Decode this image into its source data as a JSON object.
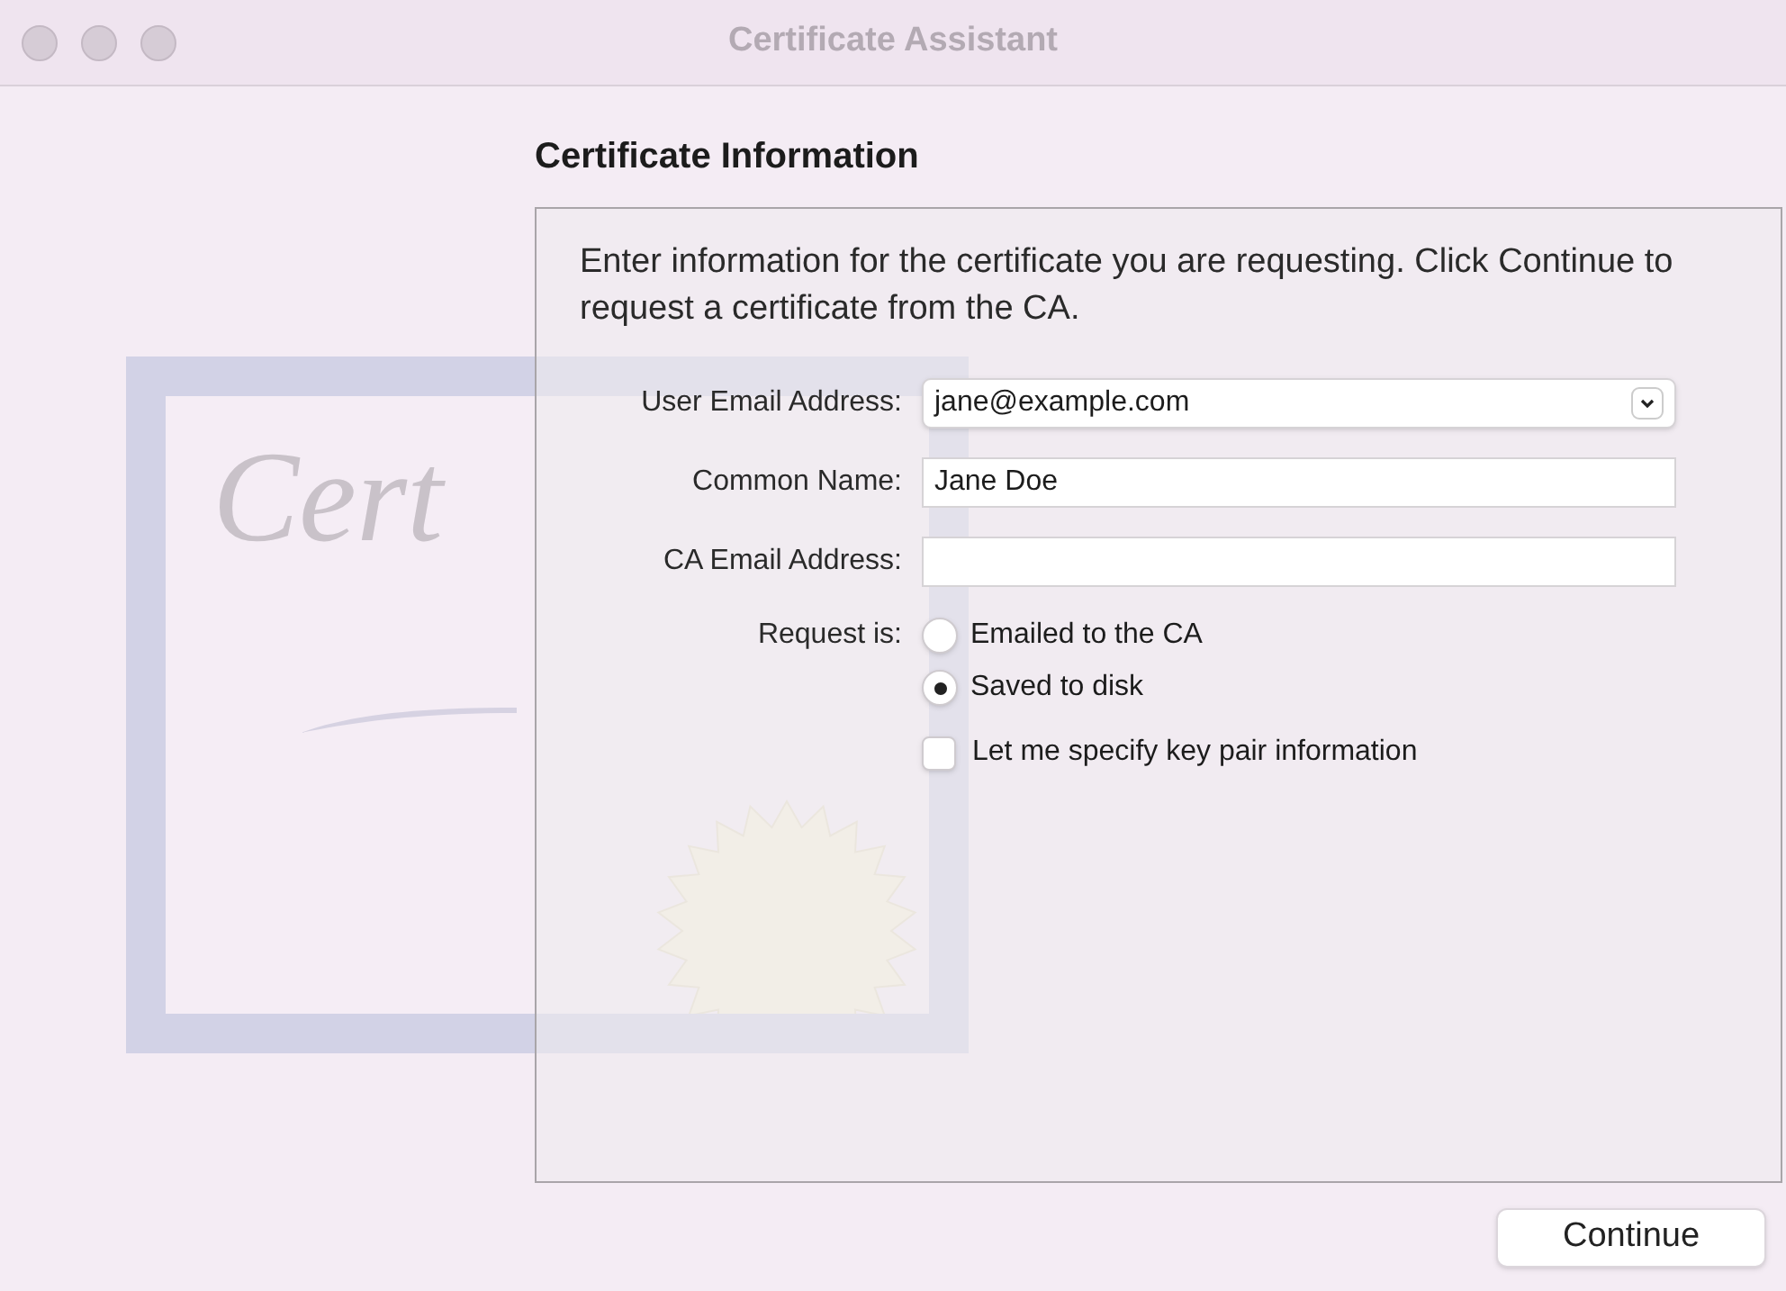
{
  "window": {
    "title": "Certificate Assistant"
  },
  "heading": "Certificate Information",
  "certificate_artwork": {
    "text": "Cert"
  },
  "intro": "Enter information for the certificate you are requesting. Click Continue to request a certificate from the CA.",
  "fields": [
    {
      "kind": "dropdown",
      "label": "User Email Address:",
      "value": "jane@example.com"
    },
    {
      "kind": "text",
      "label": "Common Name:",
      "value": "Jane Doe"
    },
    {
      "kind": "text",
      "label": "CA Email Address:"
    }
  ],
  "request": {
    "label": "Request is:",
    "options": [
      {
        "label": "Emailed to the CA",
        "selected": false
      },
      {
        "label": "Saved to disk",
        "selected": true
      }
    ]
  },
  "key_pair_option": {
    "label": "Let me specify key pair information",
    "checked": false
  },
  "buttons": [
    {
      "label": "Continue"
    }
  ]
}
